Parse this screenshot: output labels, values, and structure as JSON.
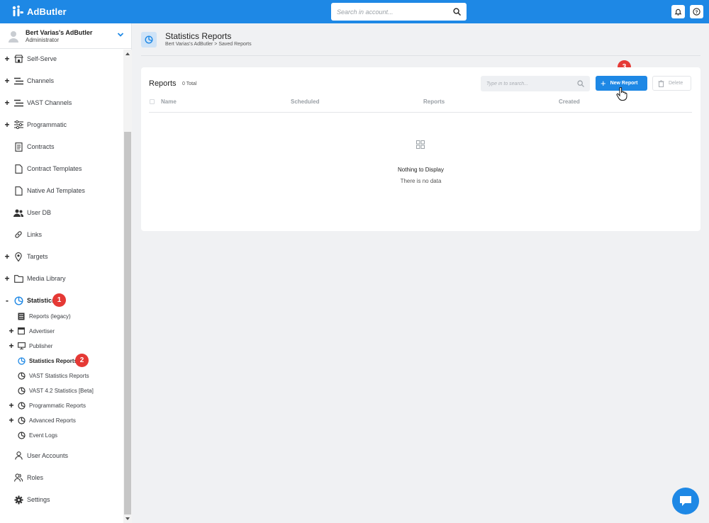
{
  "app": {
    "name": "AdButler"
  },
  "topbar": {
    "search_placeholder": "Search in account..."
  },
  "account": {
    "name": "Bert Varias's AdButler",
    "role": "Administrator"
  },
  "sidebar": {
    "items": [
      {
        "label": "Self-Serve",
        "toggle": "+",
        "icon": "store-icon"
      },
      {
        "label": "Channels",
        "toggle": "+",
        "icon": "lines-icon"
      },
      {
        "label": "VAST Channels",
        "toggle": "+",
        "icon": "lines-icon"
      },
      {
        "label": "Programmatic",
        "toggle": "+",
        "icon": "sliders-icon"
      },
      {
        "label": "Contracts",
        "toggle": "",
        "icon": "document-icon"
      },
      {
        "label": "Contract Templates",
        "toggle": "",
        "icon": "file-icon"
      },
      {
        "label": "Native Ad Templates",
        "toggle": "",
        "icon": "file-icon"
      },
      {
        "label": "User DB",
        "toggle": "",
        "icon": "users-icon"
      },
      {
        "label": "Links",
        "toggle": "",
        "icon": "link-icon"
      },
      {
        "label": "Targets",
        "toggle": "+",
        "icon": "location-pin-icon"
      },
      {
        "label": "Media Library",
        "toggle": "+",
        "icon": "folder-icon"
      },
      {
        "label": "Statistics",
        "toggle": "-",
        "icon": "pie-chart-icon"
      }
    ],
    "statistics_subitems": [
      {
        "label": "Reports (legacy)",
        "toggle": "",
        "icon": "report-icon"
      },
      {
        "label": "Advertiser",
        "toggle": "+",
        "icon": "calendar-icon"
      },
      {
        "label": "Publisher",
        "toggle": "+",
        "icon": "monitor-icon"
      },
      {
        "label": "Statistics Reports",
        "toggle": "",
        "icon": "pie-chart-icon"
      },
      {
        "label": "VAST Statistics Reports",
        "toggle": "",
        "icon": "pie-chart-icon"
      },
      {
        "label": "VAST 4.2 Statistics [Beta]",
        "toggle": "",
        "icon": "pie-chart-icon"
      },
      {
        "label": "Programmatic Reports",
        "toggle": "+",
        "icon": "pie-chart-icon"
      },
      {
        "label": "Advanced Reports",
        "toggle": "+",
        "icon": "pie-chart-icon"
      },
      {
        "label": "Event Logs",
        "toggle": "",
        "icon": "pie-chart-icon"
      }
    ],
    "bottom_items": [
      {
        "label": "User Accounts",
        "icon": "user-icon"
      },
      {
        "label": "Roles",
        "icon": "users-icon"
      },
      {
        "label": "Settings",
        "icon": "gear-icon"
      }
    ]
  },
  "badges": {
    "step1": "1",
    "step2": "2",
    "step3": "3"
  },
  "page": {
    "title": "Statistics Reports",
    "breadcrumb": "Bert Varias's AdButler  >  Saved Reports"
  },
  "reports_card": {
    "title": "Reports",
    "total": "0 Total",
    "search_placeholder": "Type in to search...",
    "new_button": "New Report",
    "delete_button": "Delete",
    "columns": [
      "Name",
      "Scheduled",
      "Reports",
      "Created"
    ],
    "empty_title": "Nothing to Display",
    "empty_subtitle": "There is no data"
  },
  "colors": {
    "brand": "#1e88e5",
    "badge": "#e53935"
  }
}
